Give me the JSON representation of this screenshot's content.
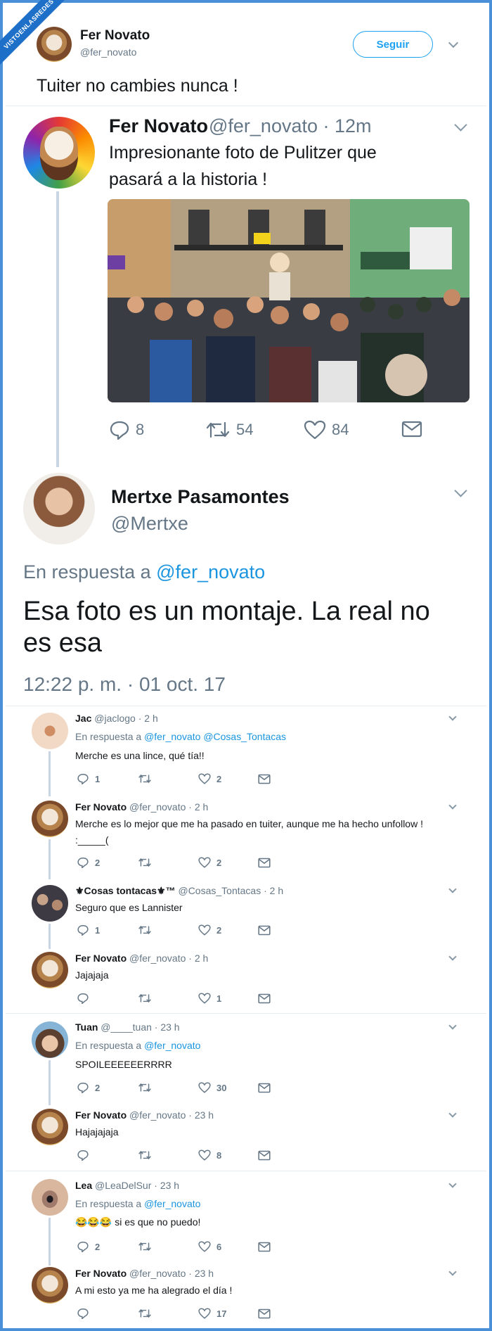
{
  "watermark": "VISTOENLASREDES",
  "colors": {
    "accent": "#1da1f2",
    "link": "#1b95e0",
    "text": "#14171a",
    "muted": "#657786",
    "frame": "#4a90d9"
  },
  "header": {
    "name": "Fer Novato",
    "handle": "@fer_novato",
    "follow_label": "Seguir",
    "text": "Tuiter no cambies nunca !"
  },
  "quoted_tweet": {
    "name": "Fer Novato",
    "meta": "@fer_novato · 12m",
    "line1": "Impresionante foto de Pulitzer que",
    "line2": "pasará a la historia !",
    "replies": "8",
    "retweets": "54",
    "likes": "84"
  },
  "main_tweet": {
    "name": "Mertxe Pasamontes",
    "handle": "@Mertxe",
    "reply_prefix": "En respuesta a",
    "reply_to": "@fer_novato",
    "line1": "Esa foto es un montaje. La real no",
    "line2": "es esa",
    "timestamp": "12:22 p. m. · 01 oct. 17"
  },
  "replies": [
    {
      "name": "Jac",
      "meta": "@jaclogo · 2 h",
      "reply_prefix": "En respuesta a",
      "reply_to": "@fer_novato @Cosas_Tontacas",
      "text": "Merche es una lince, qué tía!!",
      "replies": "1",
      "retweets": "",
      "likes": "2"
    },
    {
      "name": "Fer Novato",
      "meta": "@fer_novato · 2 h",
      "text": "Merche es lo mejor que me ha pasado en tuiter, aunque me ha hecho unfollow !",
      "text2": ":_____(",
      "replies": "2",
      "retweets": "",
      "likes": "2"
    },
    {
      "name": "⚜Cosas tontacas⚜™",
      "meta": "@Cosas_Tontacas · 2 h",
      "text": "Seguro que es Lannister",
      "replies": "1",
      "retweets": "",
      "likes": "2"
    },
    {
      "name": "Fer Novato",
      "meta": "@fer_novato · 2 h",
      "text": "Jajajaja",
      "replies": "",
      "retweets": "",
      "likes": "1"
    },
    {
      "name": "Tuan",
      "meta": "@____tuan · 23 h",
      "reply_prefix": "En respuesta a",
      "reply_to": "@fer_novato",
      "text": "SPOILEEEEEERRRR",
      "replies": "2",
      "retweets": "",
      "likes": "30"
    },
    {
      "name": "Fer Novato",
      "meta": "@fer_novato · 23 h",
      "text": "Hajajajaja",
      "replies": "",
      "retweets": "",
      "likes": "8"
    },
    {
      "name": "Lea",
      "meta": "@LeaDelSur · 23 h",
      "reply_prefix": "En respuesta a",
      "reply_to": "@fer_novato",
      "emoji": "😂😂😂",
      "text": "si es que no puedo!",
      "replies": "2",
      "retweets": "",
      "likes": "6"
    },
    {
      "name": "Fer Novato",
      "meta": "@fer_novato · 23 h",
      "text": "A mi esto ya me ha alegrado el día !",
      "replies": "",
      "retweets": "",
      "likes": "17"
    }
  ]
}
